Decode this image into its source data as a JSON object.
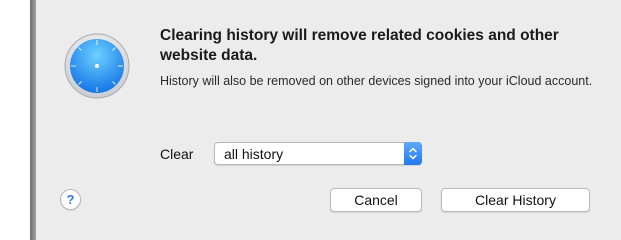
{
  "dialog": {
    "title": "Clearing history will remove related cookies and other website data.",
    "message": "History will also be removed on other devices signed into your iCloud account.",
    "clear_label": "Clear",
    "range_select": {
      "selected": "all history"
    },
    "help_glyph": "?",
    "cancel_label": "Cancel",
    "confirm_label": "Clear History"
  },
  "icons": {
    "app": "safari-compass-icon",
    "select_arrows": "up-down-chevron-icon",
    "help": "help-icon"
  },
  "colors": {
    "dialog_background": "#ececec",
    "accent_blue": "#2a7ff3",
    "compass_red": "#e63b32"
  }
}
